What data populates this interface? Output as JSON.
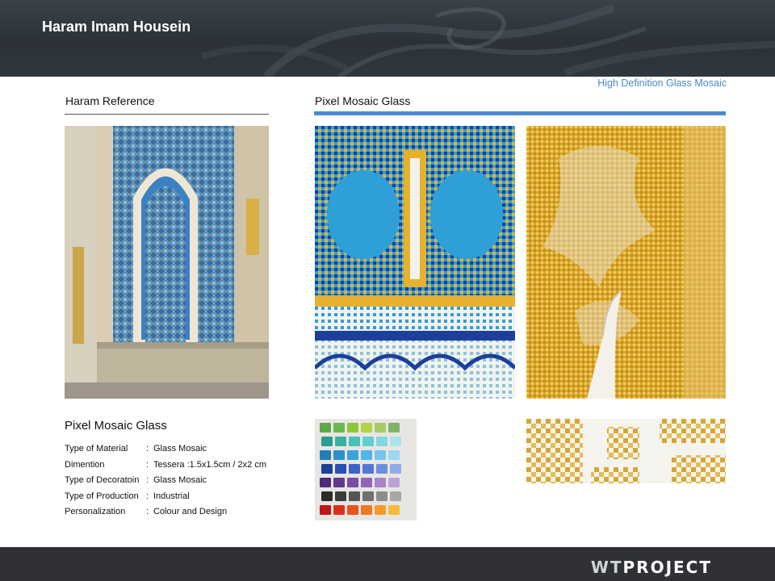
{
  "header": {
    "title": "Haram Imam Housein"
  },
  "tagline": "High Definition Glass Mosaic",
  "sections": {
    "left_label": "Haram Reference",
    "right_label": "Pixel Mosaic Glass"
  },
  "specs": {
    "title": "Pixel Mosaic Glass",
    "rows": [
      {
        "label": "Type of Material",
        "value": "Glass Mosaic"
      },
      {
        "label": "Dimention",
        "value": "Tessera :1.5x1.5cm / 2x2 cm"
      },
      {
        "label": "Type of Decoratoin",
        "value": "Glass Mosaic"
      },
      {
        "label": "Type of Production",
        "value": "Industrial"
      },
      {
        "label": "Personalization",
        "value": "Colour and Design"
      }
    ]
  },
  "footer": {
    "brand_part1": "WT",
    "brand_part2": "PROJECT"
  },
  "colors": {
    "accent_blue": "#4d8bd0",
    "header_bg": "#2b3137",
    "footer_bg": "#2f3134",
    "gold": "#e0b53a",
    "mosaic_blue": "#2f9fd8"
  },
  "swatch_rows": [
    [
      "#5da84a",
      "#6bb84f",
      "#8cc63f",
      "#b4d147",
      "#a8c96a",
      "#7fb26b"
    ],
    [
      "#2a9d8f",
      "#3ab0a2",
      "#49c2b6",
      "#5fcfd1",
      "#7fd9e0",
      "#a8e4ea"
    ],
    [
      "#1f7fb8",
      "#2a90cf",
      "#3aa2e0",
      "#52b5ea",
      "#74c6ef",
      "#9dd6f3"
    ],
    [
      "#1c3f9a",
      "#2a4fb8",
      "#3b63cc",
      "#4f79d8",
      "#6b8fe0",
      "#90abe8"
    ],
    [
      "#4d2a7a",
      "#60398f",
      "#7a4ea6",
      "#9067b8",
      "#a684c7",
      "#bca3d6"
    ],
    [
      "#2b2b2b",
      "#3d3d3d",
      "#555555",
      "#707070",
      "#8c8c8c",
      "#a8a8a8"
    ],
    [
      "#c0151a",
      "#d9301c",
      "#e8531d",
      "#f07a1f",
      "#f59c2a",
      "#f7bd3a"
    ]
  ]
}
